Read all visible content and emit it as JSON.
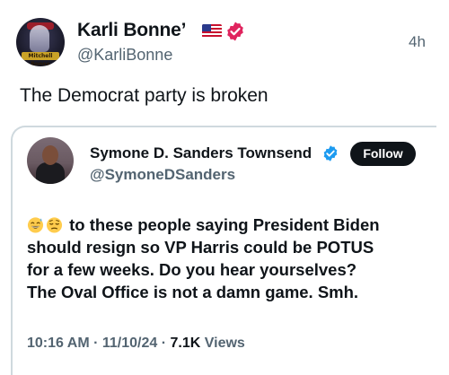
{
  "post": {
    "author_name": "Karli Bonne’",
    "author_handle": "@KarliBonne",
    "timestamp": "4h",
    "avatar_label": "Mitchell Bonne",
    "text": "The Democrat party is broken"
  },
  "quote": {
    "author_name": "Symone D. Sanders Townsend",
    "author_handle": "@SymoneDSanders",
    "follow_label": "Follow",
    "body_lines": [
      "to these people saying President Biden",
      "should resign so VP Harris could be POTUS",
      "for a few weeks. Do you hear yourselves?",
      "The Oval Office is not a damn game. Smh."
    ],
    "meta": {
      "time": "10:16 AM",
      "separator": " · ",
      "date": "11/10/24",
      "views_count": "7.1K",
      "views_label": " Views"
    }
  },
  "icons": {
    "flag": "us-flag-icon",
    "verified_outer": "verified-badge-red-icon",
    "verified_quote": "verified-badge-blue-icon",
    "emoji_1": "sweat-smile-emoji",
    "emoji_2": "relieved-emoji"
  },
  "colors": {
    "text_primary": "#0f1419",
    "text_secondary": "#536471",
    "verified_red": "#e0245e",
    "verified_blue": "#1d9bf0",
    "follow_bg": "#0f1419",
    "card_border": "#cfd9de"
  }
}
